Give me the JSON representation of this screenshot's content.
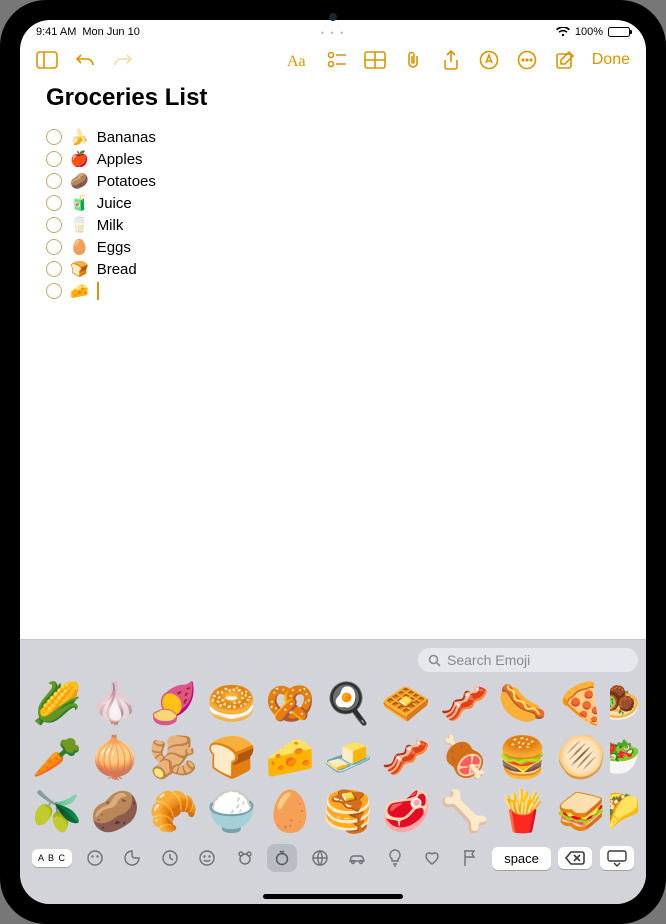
{
  "status": {
    "time": "9:41 AM",
    "date": "Mon Jun 10",
    "battery_pct": "100%"
  },
  "toolbar": {
    "done_label": "Done"
  },
  "note": {
    "title": "Groceries List",
    "items": [
      {
        "emoji": "🍌",
        "text": "Bananas"
      },
      {
        "emoji": "🍎",
        "text": "Apples"
      },
      {
        "emoji": "🥔",
        "text": "Potatoes"
      },
      {
        "emoji": "🧃",
        "text": "Juice"
      },
      {
        "emoji": "🥛",
        "text": "Milk"
      },
      {
        "emoji": "🥚",
        "text": "Eggs"
      },
      {
        "emoji": "🍞",
        "text": "Bread"
      }
    ],
    "active_item_emoji": "🧀"
  },
  "keyboard": {
    "search_placeholder": "Search Emoji",
    "abc_label": "A B C",
    "space_label": "space",
    "emojis": [
      "🌽",
      "🧄",
      "🍠",
      "🥯",
      "🥨",
      "🍳",
      "🧇",
      "🥓",
      "🌭",
      "🍕",
      "🥕",
      "🧅",
      "🫚",
      "🍞",
      "🧀",
      "🧈",
      "🥓",
      "🍖",
      "🍔",
      "🫓",
      "🫒",
      "🥔",
      "🥐",
      "🍚",
      "🥚",
      "🥞",
      "🥩",
      "🦴",
      "🍟",
      "🥪"
    ],
    "partial_col": [
      "🧆",
      "🥗",
      "🌮"
    ]
  },
  "colors": {
    "accent": "#d89500"
  }
}
